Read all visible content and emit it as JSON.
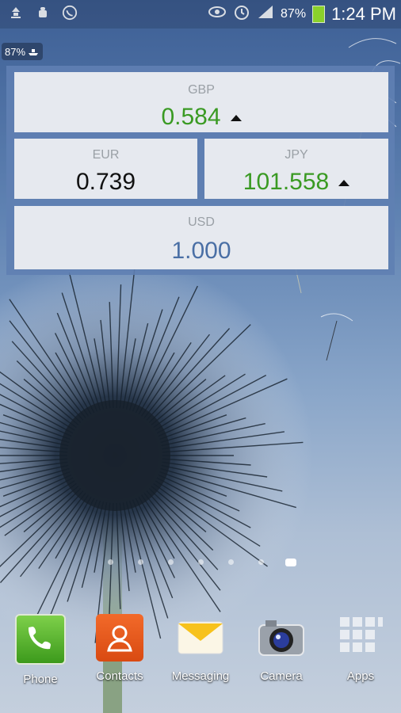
{
  "status_bar": {
    "icons": [
      "upload-icon",
      "android-debug-icon",
      "whatsapp-icon"
    ],
    "right_icons": [
      "eye-icon",
      "alarm-icon",
      "signal-icon",
      "battery-icon"
    ],
    "battery": "87%",
    "time": "1:24 PM"
  },
  "battery_widget": {
    "label": "87%"
  },
  "currency_widget": {
    "gbp": {
      "code": "GBP",
      "value": "0.584",
      "trend": "up",
      "color": "#3a9a23"
    },
    "eur": {
      "code": "EUR",
      "value": "0.739",
      "color": "#111111"
    },
    "jpy": {
      "code": "JPY",
      "value": "101.558",
      "trend": "up",
      "color": "#3a9a23"
    },
    "usd": {
      "code": "USD",
      "value": "1.000",
      "color": "#4a6fa5"
    }
  },
  "home_pages": {
    "count": 7,
    "active_index": 6
  },
  "dock": {
    "apps": [
      {
        "label": "Phone",
        "icon": "phone-icon"
      },
      {
        "label": "Contacts",
        "icon": "contacts-icon"
      },
      {
        "label": "Messaging",
        "icon": "messaging-icon"
      },
      {
        "label": "Camera",
        "icon": "camera-icon"
      },
      {
        "label": "Apps",
        "icon": "apps-grid-icon"
      }
    ]
  }
}
